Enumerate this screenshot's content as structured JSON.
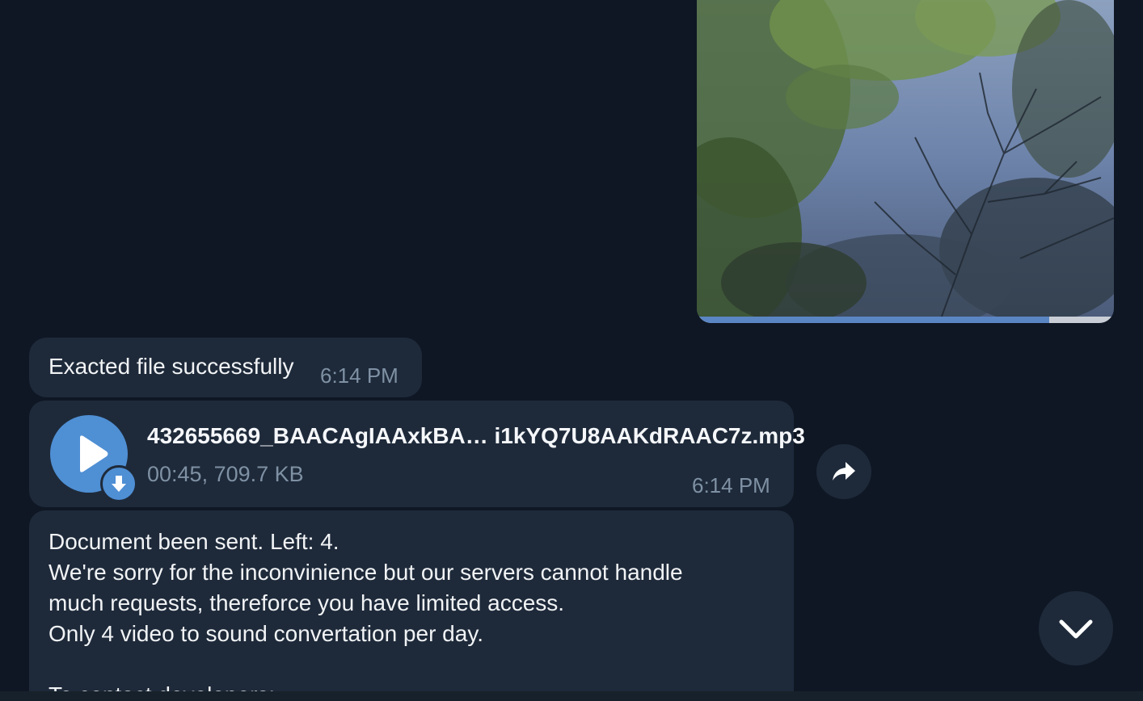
{
  "media": {
    "icon": "video-thumbnail",
    "progress_fraction": 0.845
  },
  "messages": [
    {
      "text": "Exacted file successfully",
      "time": "6:14 PM"
    },
    {
      "file_name": "432655669_BAACAgIAAxkBA… i1kYQ7U8AAKdRAAC7z.mp3",
      "file_meta": "00:45, 709.7 KB",
      "time": "6:14 PM",
      "play_icon": "play-icon",
      "download_icon": "download-icon"
    },
    {
      "line1_prefix": "Document been sent. Left: ",
      "line1_count": "4",
      "line1_suffix": ".",
      "line2": "We're sorry for the inconvinience but our servers cannot handle",
      "line3": "much requests, thereforce you have limited access.",
      "line4": "Only 4 video to sound convertation per day.",
      "line6": "To contact developers:"
    }
  ],
  "controls": {
    "share_icon": "share-icon",
    "scroll_down_icon": "chevron-down-icon"
  },
  "colors": {
    "background": "#0f1724",
    "bubble": "#1e2a3a",
    "accent": "#4f8fd4",
    "muted_text": "#7f91a4"
  }
}
